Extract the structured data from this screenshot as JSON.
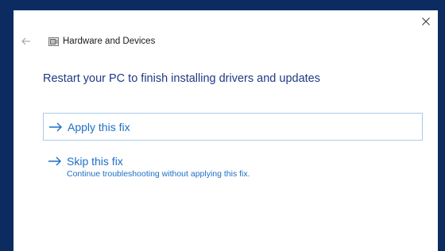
{
  "window": {
    "title": "Hardware and Devices",
    "close_glyph": "×"
  },
  "nav": {
    "back_icon": "back-arrow-icon",
    "app_icon": "hardware-devices-icon"
  },
  "main": {
    "heading": "Restart your PC to finish installing drivers and updates",
    "options": [
      {
        "label": "Apply this fix",
        "description": ""
      },
      {
        "label": "Skip this fix",
        "description": "Continue troubleshooting without applying this fix."
      }
    ]
  },
  "colors": {
    "desktop_bg": "#0b2b61",
    "heading": "#1f3a86",
    "link": "#1c6fc6",
    "option_border": "#a9cbea"
  }
}
